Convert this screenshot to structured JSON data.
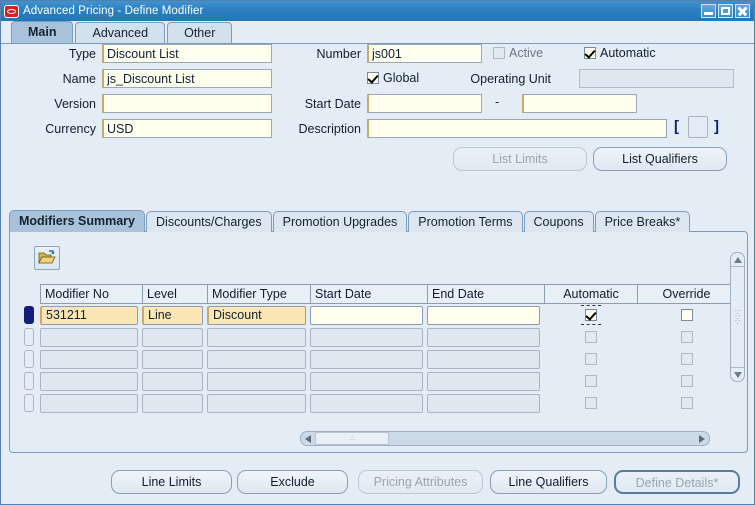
{
  "window": {
    "title": "Advanced Pricing - Define Modifier",
    "logo_icon": "oracle-logo-icon",
    "controls": {
      "minimize": "minimize-icon",
      "maximize": "maximize-icon",
      "close": "close-icon"
    }
  },
  "top_tabs": [
    {
      "label": "Main",
      "active": true
    },
    {
      "label": "Advanced",
      "active": false
    },
    {
      "label": "Other",
      "active": false
    }
  ],
  "header_form": {
    "labels": {
      "type": "Type",
      "name": "Name",
      "version": "Version",
      "currency": "Currency",
      "number": "Number",
      "start_date": "Start Date",
      "description": "Description",
      "operating_unit": "Operating Unit",
      "date_separator": "-",
      "bracket_open": "[",
      "bracket_close": "]"
    },
    "values": {
      "type": "Discount List",
      "name": "js_Discount List",
      "version": "",
      "currency": "USD",
      "number": "js001",
      "start_date_from": "",
      "start_date_to": "",
      "description": "",
      "operating_unit": ""
    },
    "checkboxes": {
      "active": {
        "label": "Active",
        "checked": false,
        "enabled": false
      },
      "automatic": {
        "label": "Automatic",
        "checked": true,
        "enabled": true
      },
      "global": {
        "label": "Global",
        "checked": true,
        "enabled": true
      }
    },
    "buttons": {
      "list_limits": {
        "label": "List Limits",
        "enabled": false
      },
      "list_qualifiers": {
        "label": "List Qualifiers",
        "enabled": true
      }
    }
  },
  "bottom_tabs": [
    {
      "label": "Modifiers Summary",
      "active": true
    },
    {
      "label": "Discounts/Charges",
      "active": false
    },
    {
      "label": "Promotion Upgrades",
      "active": false
    },
    {
      "label": "Promotion Terms",
      "active": false
    },
    {
      "label": "Coupons",
      "active": false
    },
    {
      "label": "Price Breaks*",
      "active": false
    }
  ],
  "grid": {
    "folder_icon": "folder-open-icon",
    "columns": [
      "Modifier No",
      "Level",
      "Modifier Type",
      "Start Date",
      "End Date",
      "Automatic",
      "Override"
    ],
    "rows": [
      {
        "current": true,
        "modifier_no": "531211",
        "level": "Line",
        "modifier_type": "Discount",
        "start_date": "",
        "end_date": "",
        "automatic": true,
        "override": false
      },
      {
        "current": false,
        "modifier_no": "",
        "level": "",
        "modifier_type": "",
        "start_date": "",
        "end_date": "",
        "automatic": false,
        "override": false
      },
      {
        "current": false,
        "modifier_no": "",
        "level": "",
        "modifier_type": "",
        "start_date": "",
        "end_date": "",
        "automatic": false,
        "override": false
      },
      {
        "current": false,
        "modifier_no": "",
        "level": "",
        "modifier_type": "",
        "start_date": "",
        "end_date": "",
        "automatic": false,
        "override": false
      },
      {
        "current": false,
        "modifier_no": "",
        "level": "",
        "modifier_type": "",
        "start_date": "",
        "end_date": "",
        "automatic": false,
        "override": false
      }
    ],
    "scroll": {
      "up_arrow": "scroll-up-icon",
      "down_arrow": "scroll-down-icon",
      "left_arrow": "scroll-left-icon",
      "right_arrow": "scroll-right-icon"
    }
  },
  "bottom_buttons": [
    {
      "label": "Line Limits",
      "enabled": true,
      "default": false
    },
    {
      "label": "Exclude",
      "enabled": true,
      "default": false
    },
    {
      "label": "Pricing Attributes",
      "enabled": false,
      "default": false
    },
    {
      "label": "Line Qualifiers",
      "enabled": true,
      "default": false
    },
    {
      "label": "Define Details*",
      "enabled": false,
      "default": true
    }
  ],
  "colors": {
    "titlebar": "#2a80c0",
    "canvas": "#e4ecf5",
    "tab_active": "#a9c2db",
    "tab_inactive": "#dce6f0",
    "field_bg": "#fffff0",
    "current_row_cell": "#fbe7b5",
    "record_indicator": "#151c7e",
    "oracle_red": "#d81f26"
  }
}
